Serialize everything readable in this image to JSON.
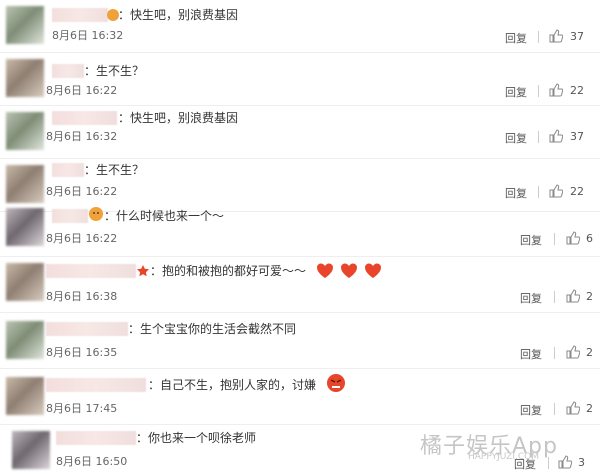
{
  "comments": [
    {
      "text": "：快生吧，别浪费基因",
      "date": "8月6日  16:32",
      "reply": "回复",
      "likes": "37"
    },
    {
      "text": "：生不生？",
      "date": "8月6日  16:22",
      "reply": "回复",
      "likes": "22"
    },
    {
      "text": "：快生吧，别浪费基因",
      "date": "8月6日  16:32",
      "reply": "回复",
      "likes": "37"
    },
    {
      "text": "：生不生？",
      "date": "8月6日  16:22",
      "reply": "回复",
      "likes": "22"
    },
    {
      "text": "：什么时候也来一个～",
      "date": "8月6日  16:22",
      "reply": "回复",
      "likes": "6"
    },
    {
      "text": "：抱的和被抱的都好可爱～～",
      "date": "8月6日  16:38",
      "reply": "回复",
      "likes": "2"
    },
    {
      "text": "：生个宝宝你的生活会截然不同",
      "date": "8月6日  16:35",
      "reply": "回复",
      "likes": "2"
    },
    {
      "text": "：自己不生，抱别人家的，讨嫌",
      "date": "8月6日  17:45",
      "reply": "回复",
      "likes": "2"
    },
    {
      "text": "：你也来一个呗徐老师",
      "date": "8月6日  16:50",
      "reply": "回复",
      "likes": "3"
    }
  ],
  "watermark": {
    "brand": "橘子娱乐App",
    "site": "HAPPYJUZI.COM"
  },
  "colors": {
    "heart": "#e8452a",
    "like_icon": "#888888",
    "badge": "#f0a23a"
  }
}
